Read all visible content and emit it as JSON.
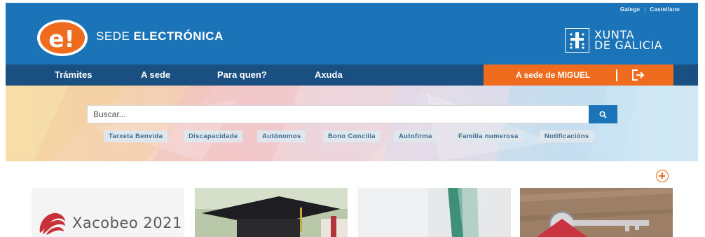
{
  "header": {
    "logo_text": "e!",
    "title_light": "SEDE",
    "title_bold": "ELECTRÓNICA",
    "languages": [
      "Galego",
      "Castellano"
    ],
    "language_separator": "|",
    "xunta_line1": "XUNTA",
    "xunta_line2": "DE GALICIA"
  },
  "nav": {
    "items": [
      "Trámites",
      "A sede",
      "Para quen?",
      "Axuda"
    ],
    "user_label": "A sede de MIGUEL"
  },
  "search": {
    "placeholder": "Buscar...",
    "tags": [
      "Tarxeta Benvida",
      "Discapacidade",
      "Autónomos",
      "Bono Concilia",
      "Autofirma",
      "Familia numerosa",
      "Notificacións"
    ]
  },
  "cards": [
    {
      "title": "Xacobeo 2021"
    },
    {
      "title": ""
    },
    {
      "title": ""
    },
    {
      "title": ""
    }
  ],
  "colors": {
    "header_blue": "#1b73b8",
    "nav_blue": "#1a4f82",
    "accent_orange": "#ef6c1f"
  },
  "icons": [
    "search-icon",
    "logout-icon",
    "plus-circle-icon",
    "xunta-emblem-icon",
    "xacobeo-shell-icon"
  ]
}
